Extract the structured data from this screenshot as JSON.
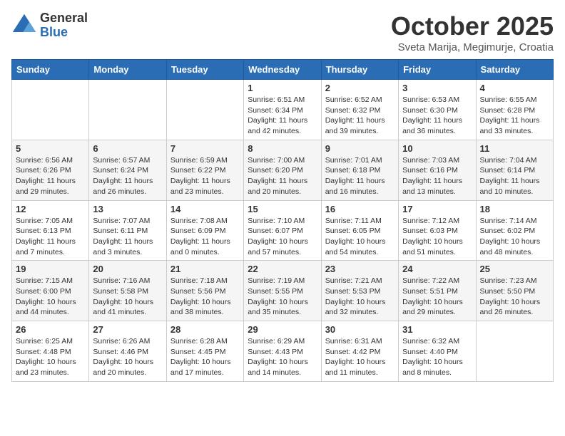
{
  "header": {
    "logo_general": "General",
    "logo_blue": "Blue",
    "month_title": "October 2025",
    "location": "Sveta Marija, Megimurje, Croatia"
  },
  "weekdays": [
    "Sunday",
    "Monday",
    "Tuesday",
    "Wednesday",
    "Thursday",
    "Friday",
    "Saturday"
  ],
  "weeks": [
    [
      {
        "day": "",
        "info": ""
      },
      {
        "day": "",
        "info": ""
      },
      {
        "day": "",
        "info": ""
      },
      {
        "day": "1",
        "info": "Sunrise: 6:51 AM\nSunset: 6:34 PM\nDaylight: 11 hours and 42 minutes."
      },
      {
        "day": "2",
        "info": "Sunrise: 6:52 AM\nSunset: 6:32 PM\nDaylight: 11 hours and 39 minutes."
      },
      {
        "day": "3",
        "info": "Sunrise: 6:53 AM\nSunset: 6:30 PM\nDaylight: 11 hours and 36 minutes."
      },
      {
        "day": "4",
        "info": "Sunrise: 6:55 AM\nSunset: 6:28 PM\nDaylight: 11 hours and 33 minutes."
      }
    ],
    [
      {
        "day": "5",
        "info": "Sunrise: 6:56 AM\nSunset: 6:26 PM\nDaylight: 11 hours and 29 minutes."
      },
      {
        "day": "6",
        "info": "Sunrise: 6:57 AM\nSunset: 6:24 PM\nDaylight: 11 hours and 26 minutes."
      },
      {
        "day": "7",
        "info": "Sunrise: 6:59 AM\nSunset: 6:22 PM\nDaylight: 11 hours and 23 minutes."
      },
      {
        "day": "8",
        "info": "Sunrise: 7:00 AM\nSunset: 6:20 PM\nDaylight: 11 hours and 20 minutes."
      },
      {
        "day": "9",
        "info": "Sunrise: 7:01 AM\nSunset: 6:18 PM\nDaylight: 11 hours and 16 minutes."
      },
      {
        "day": "10",
        "info": "Sunrise: 7:03 AM\nSunset: 6:16 PM\nDaylight: 11 hours and 13 minutes."
      },
      {
        "day": "11",
        "info": "Sunrise: 7:04 AM\nSunset: 6:14 PM\nDaylight: 11 hours and 10 minutes."
      }
    ],
    [
      {
        "day": "12",
        "info": "Sunrise: 7:05 AM\nSunset: 6:13 PM\nDaylight: 11 hours and 7 minutes."
      },
      {
        "day": "13",
        "info": "Sunrise: 7:07 AM\nSunset: 6:11 PM\nDaylight: 11 hours and 3 minutes."
      },
      {
        "day": "14",
        "info": "Sunrise: 7:08 AM\nSunset: 6:09 PM\nDaylight: 11 hours and 0 minutes."
      },
      {
        "day": "15",
        "info": "Sunrise: 7:10 AM\nSunset: 6:07 PM\nDaylight: 10 hours and 57 minutes."
      },
      {
        "day": "16",
        "info": "Sunrise: 7:11 AM\nSunset: 6:05 PM\nDaylight: 10 hours and 54 minutes."
      },
      {
        "day": "17",
        "info": "Sunrise: 7:12 AM\nSunset: 6:03 PM\nDaylight: 10 hours and 51 minutes."
      },
      {
        "day": "18",
        "info": "Sunrise: 7:14 AM\nSunset: 6:02 PM\nDaylight: 10 hours and 48 minutes."
      }
    ],
    [
      {
        "day": "19",
        "info": "Sunrise: 7:15 AM\nSunset: 6:00 PM\nDaylight: 10 hours and 44 minutes."
      },
      {
        "day": "20",
        "info": "Sunrise: 7:16 AM\nSunset: 5:58 PM\nDaylight: 10 hours and 41 minutes."
      },
      {
        "day": "21",
        "info": "Sunrise: 7:18 AM\nSunset: 5:56 PM\nDaylight: 10 hours and 38 minutes."
      },
      {
        "day": "22",
        "info": "Sunrise: 7:19 AM\nSunset: 5:55 PM\nDaylight: 10 hours and 35 minutes."
      },
      {
        "day": "23",
        "info": "Sunrise: 7:21 AM\nSunset: 5:53 PM\nDaylight: 10 hours and 32 minutes."
      },
      {
        "day": "24",
        "info": "Sunrise: 7:22 AM\nSunset: 5:51 PM\nDaylight: 10 hours and 29 minutes."
      },
      {
        "day": "25",
        "info": "Sunrise: 7:23 AM\nSunset: 5:50 PM\nDaylight: 10 hours and 26 minutes."
      }
    ],
    [
      {
        "day": "26",
        "info": "Sunrise: 6:25 AM\nSunset: 4:48 PM\nDaylight: 10 hours and 23 minutes."
      },
      {
        "day": "27",
        "info": "Sunrise: 6:26 AM\nSunset: 4:46 PM\nDaylight: 10 hours and 20 minutes."
      },
      {
        "day": "28",
        "info": "Sunrise: 6:28 AM\nSunset: 4:45 PM\nDaylight: 10 hours and 17 minutes."
      },
      {
        "day": "29",
        "info": "Sunrise: 6:29 AM\nSunset: 4:43 PM\nDaylight: 10 hours and 14 minutes."
      },
      {
        "day": "30",
        "info": "Sunrise: 6:31 AM\nSunset: 4:42 PM\nDaylight: 10 hours and 11 minutes."
      },
      {
        "day": "31",
        "info": "Sunrise: 6:32 AM\nSunset: 4:40 PM\nDaylight: 10 hours and 8 minutes."
      },
      {
        "day": "",
        "info": ""
      }
    ]
  ]
}
